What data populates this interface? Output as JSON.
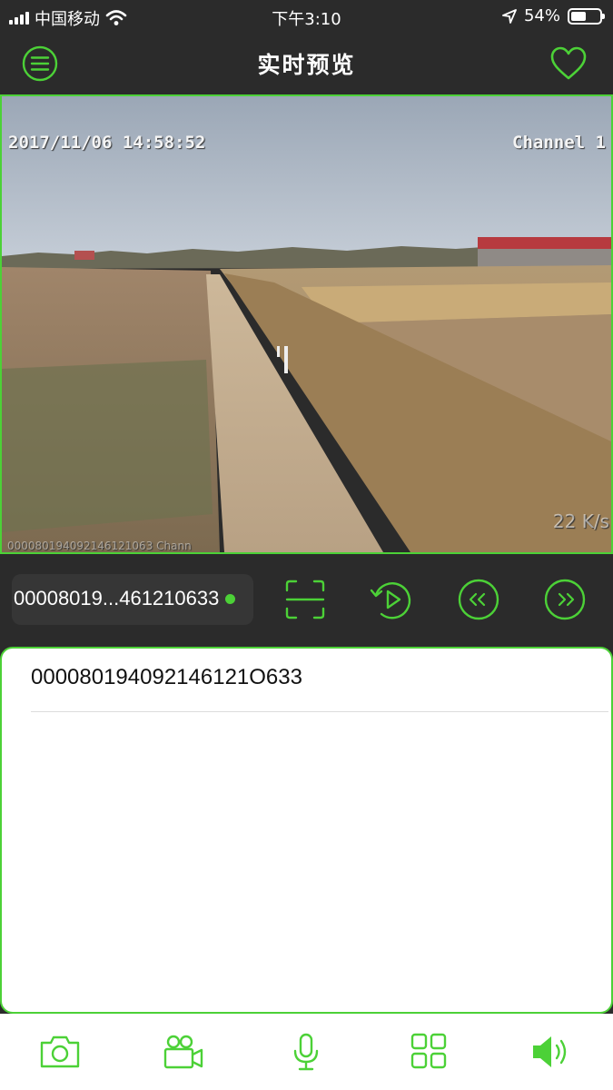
{
  "status_bar": {
    "carrier": "中国移动",
    "time": "下午3:10",
    "battery_text": "54%",
    "battery_level": 0.54
  },
  "nav": {
    "title": "实时预览"
  },
  "video": {
    "timestamp": "2017/11/06 14:58:52",
    "channel": "Channel 1",
    "bitrate": "22 K/s",
    "watermark": "000080194092146121063 Chann"
  },
  "controls": {
    "device_label": "00008019...461210633"
  },
  "list": {
    "items": [
      {
        "label": "000080194092146121O633"
      }
    ]
  },
  "colors": {
    "accent": "#4cd137",
    "header_bg": "#2b2b2b"
  },
  "icons": {
    "menu": "menu-icon",
    "favorite": "heart-icon",
    "scan": "scan-icon",
    "replay": "replay-icon",
    "prev": "prev-icon",
    "next": "next-icon",
    "photo": "camera-icon",
    "record": "video-camera-icon",
    "mic": "microphone-icon",
    "grid": "grid-icon",
    "sound": "speaker-icon"
  }
}
